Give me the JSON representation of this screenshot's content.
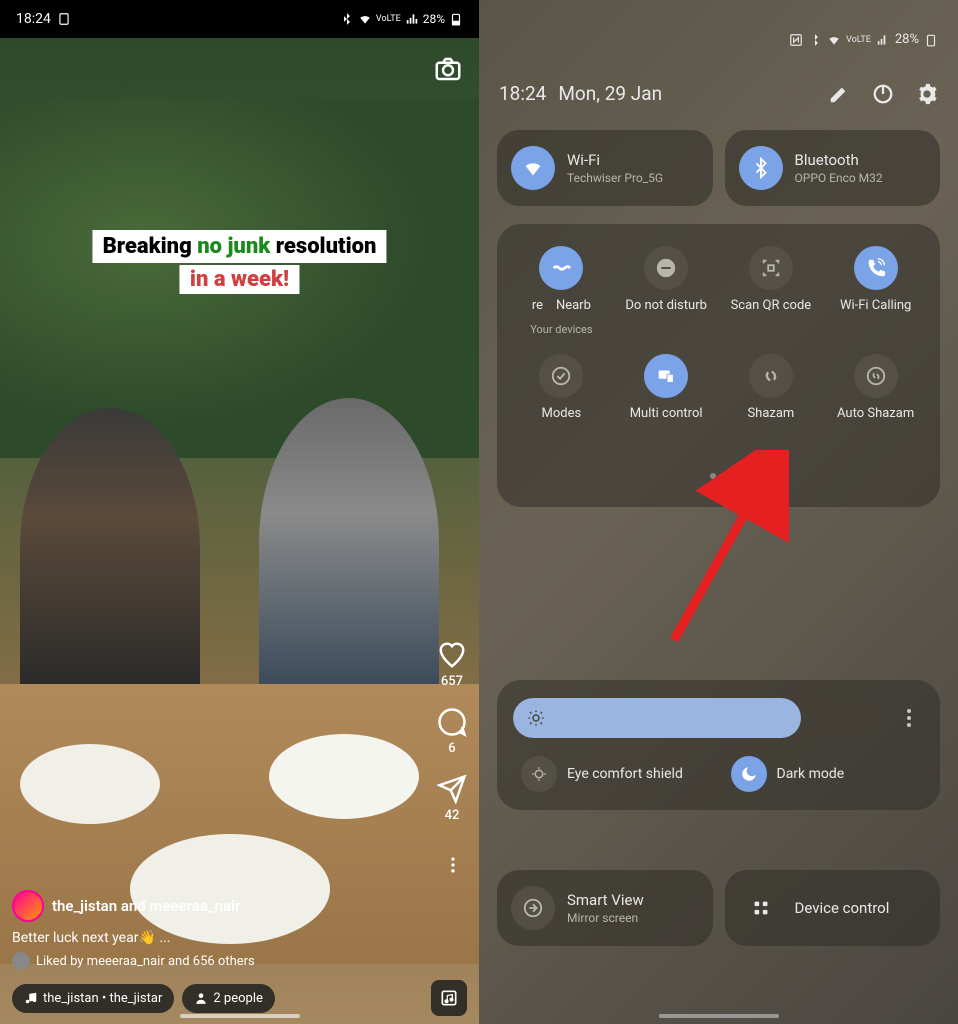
{
  "left_phone": {
    "status": {
      "time": "18:24",
      "battery": "28%",
      "network": "VoLTE"
    },
    "story": {
      "overlay_text_1_a": "Breaking",
      "overlay_text_1_b": "no junk",
      "overlay_text_1_c": "resolution",
      "overlay_text_2": "in a week!",
      "likes": "657",
      "comments": "6",
      "shares": "42",
      "username_line": "the_jistan and meeeraa_nair",
      "caption": "Better luck next year👋 ...",
      "liked_by": "Liked by meeeraa_nair and 656 others",
      "music_pill": "the_jistan • the_jistar",
      "people_pill": "2 people"
    }
  },
  "right_phone": {
    "status": {
      "battery": "28%"
    },
    "header": {
      "time": "18:24",
      "date": "Mon, 29 Jan"
    },
    "tiles": {
      "wifi": {
        "title": "Wi-Fi",
        "sub": "Techwiser Pro_5G"
      },
      "bluetooth": {
        "title": "Bluetooth",
        "sub": "OPPO Enco M32"
      },
      "nearby": {
        "title": "Nearb",
        "partial": "re",
        "sub": "Your devices"
      },
      "dnd": "Do not disturb",
      "qr": "Scan QR code",
      "wificall": "Wi-Fi Calling",
      "modes": "Modes",
      "multi": "Multi control",
      "shazam": "Shazam",
      "autoshazam": "Auto Shazam"
    },
    "toggles": {
      "eye": "Eye comfort shield",
      "dark": "Dark mode"
    },
    "bottom": {
      "smartview": {
        "title": "Smart View",
        "sub": "Mirror screen"
      },
      "device": "Device control"
    },
    "brightness_percent": 78
  }
}
